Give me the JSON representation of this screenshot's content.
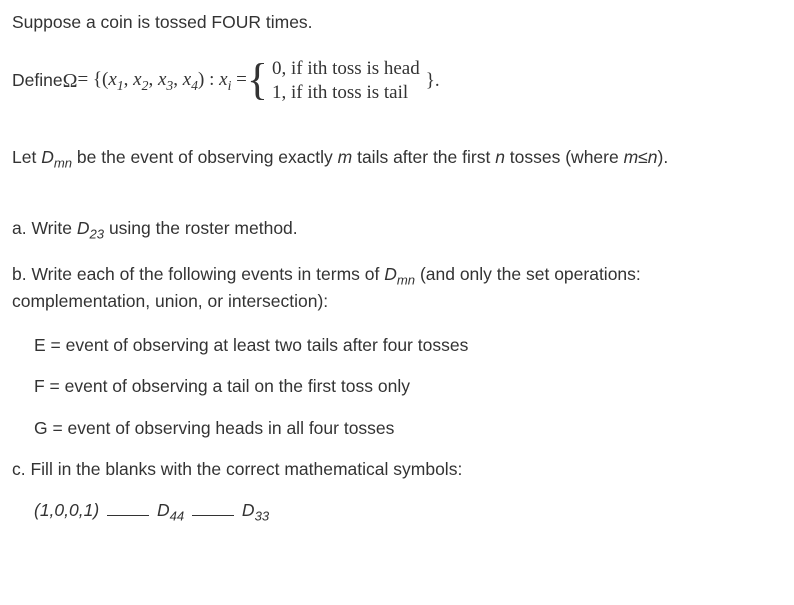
{
  "intro": "Suppose a coin is tossed FOUR times.",
  "define_prefix": "Define ",
  "omega": "Ω",
  "eq1": " = {(",
  "x1": "x",
  "x1s": "1",
  "comma": ", ",
  "x2": "x",
  "x2s": "2",
  "x3": "x",
  "x3s": "3",
  "x4": "x",
  "x4s": "4",
  "close_set": ") : ",
  "xi": "x",
  "xis": "i",
  "eq2": " = ",
  "case0": "0, if ith toss is head",
  "case1": "1, if ith toss is tail",
  "close_brace_period": "}.",
  "let_line_a": "Let ",
  "D": "D",
  "mn": "mn",
  "let_line_b": " be the event of observing exactly ",
  "m_it": "m",
  "let_line_c": " tails after the first ",
  "n_it": "n",
  "let_line_d": " tosses (where ",
  "mn_cond": "m≤n",
  "let_line_e": ").",
  "a_line_a": "a. Write ",
  "D23": "D",
  "sub23": "23",
  "a_line_b": " using the roster method.",
  "b_line": "b. Write each of the following events in terms of ",
  "b_line2": " (and only the set operations: complementation, union, or intersection):",
  "e_line": "E  = event of observing at least two tails after four tosses",
  "f_line": "F = event of observing a tail on the first toss only",
  "g_line": "G = event of observing heads in all four tosses",
  "c_line": "c. Fill in the blanks with the correct mathematical symbols:",
  "tuple": "(1,0,0,1)",
  "D44": "D",
  "sub44": "44",
  "D33": "D",
  "sub33": "33"
}
